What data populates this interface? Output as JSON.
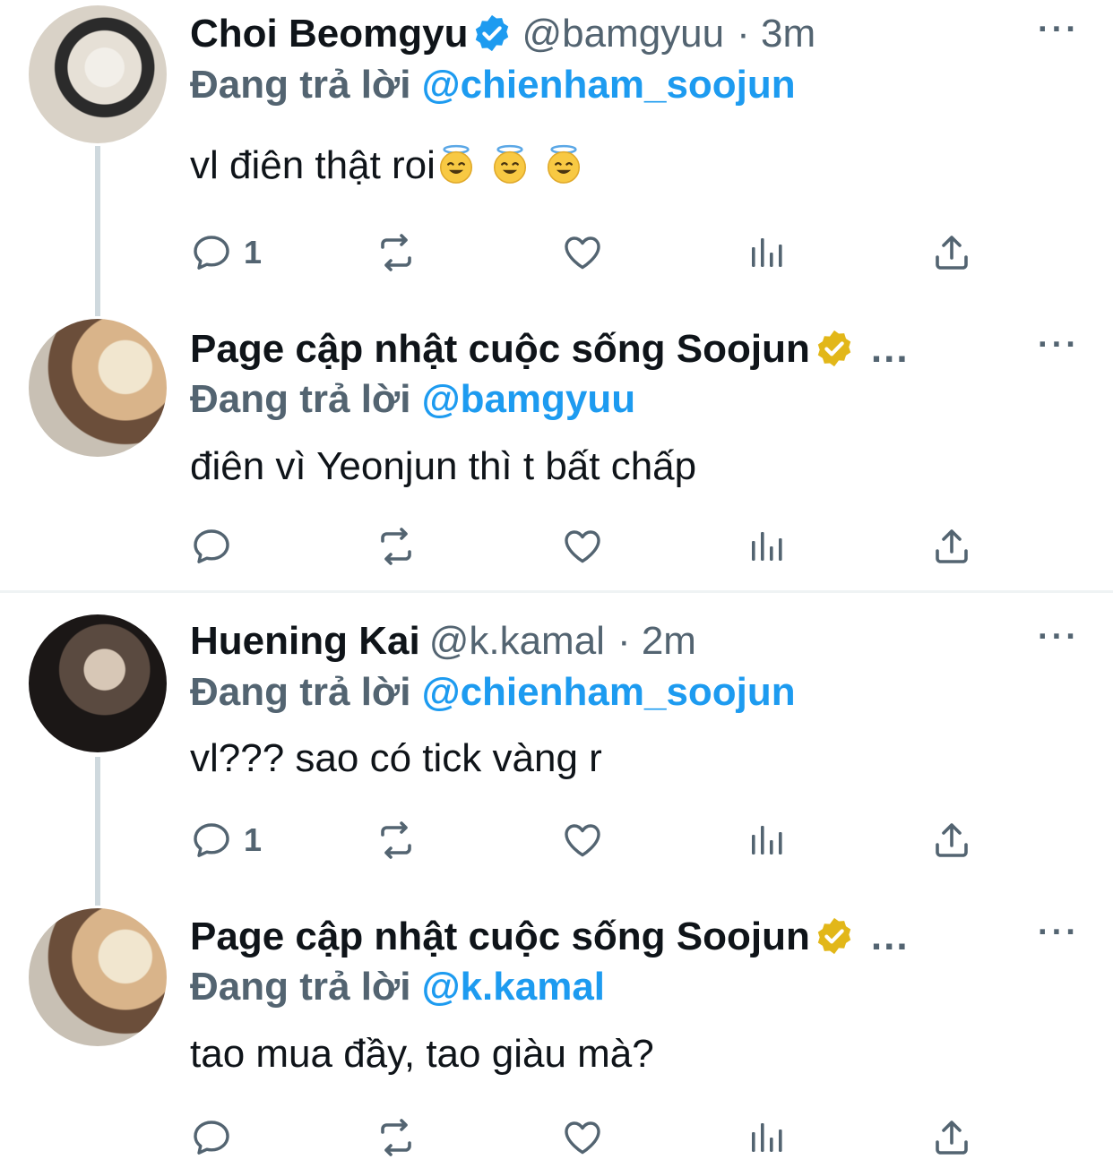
{
  "colors": {
    "link": "#1d9bf0",
    "muted": "#536471",
    "text": "#0f1419",
    "gold": "#e2b719",
    "blue": "#1d9bf0"
  },
  "tweets": [
    {
      "name": "Choi Beomgyu",
      "verified": "blue-check-icon",
      "handle": "@bamgyuu",
      "time": "· 3m",
      "reply_prefix": "Đang trả lời",
      "reply_to": "@chienham_soojun",
      "text": "vl điên thật roi",
      "emojis": [
        "halo-smile-emoji",
        "halo-smile-emoji",
        "halo-smile-emoji"
      ],
      "reply_count": "1",
      "more": "···"
    },
    {
      "name": "Page cập nhật cuộc sống Soojun",
      "verified": "gold-check-icon",
      "truncated": "...",
      "reply_prefix": "Đang trả lời",
      "reply_to": "@bamgyuu",
      "text": "điên vì Yeonjun thì t bất chấp",
      "reply_count": "",
      "more": "···"
    },
    {
      "name": "Huening Kai",
      "handle": "@k.kamal",
      "time": "· 2m",
      "reply_prefix": "Đang trả lời",
      "reply_to": "@chienham_soojun",
      "text": "vl??? sao có tick vàng r",
      "reply_count": "1",
      "more": "···"
    },
    {
      "name": "Page cập nhật cuộc sống Soojun",
      "verified": "gold-check-icon",
      "truncated": "...",
      "reply_prefix": "Đang trả lời",
      "reply_to": "@k.kamal",
      "text": "tao mua đầy, tao giàu mà?",
      "reply_count": "",
      "more": "···"
    }
  ]
}
